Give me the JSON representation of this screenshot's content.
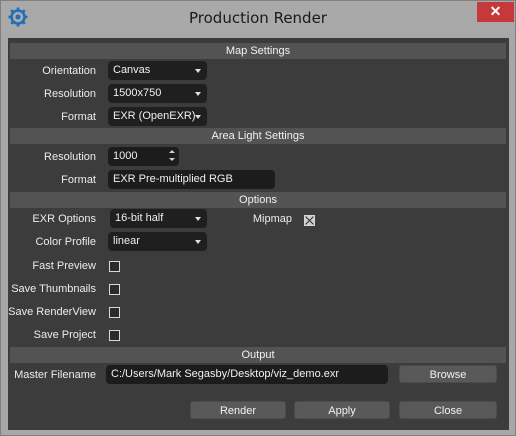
{
  "window": {
    "title": "Production Render",
    "close_glyph": "✕",
    "app_icon": "gear-icon"
  },
  "sections": {
    "map_settings": "Map Settings",
    "area_light_settings": "Area Light Settings",
    "options": "Options",
    "output": "Output"
  },
  "map_settings": {
    "orientation": {
      "label": "Orientation",
      "value": "Canvas"
    },
    "resolution": {
      "label": "Resolution",
      "value": "1500x750"
    },
    "format": {
      "label": "Format",
      "value": "EXR (OpenEXR)"
    }
  },
  "area_light_settings": {
    "resolution": {
      "label": "Resolution",
      "value": "1000"
    },
    "format": {
      "label": "Format",
      "value": "EXR Pre-multiplied RGB"
    }
  },
  "options": {
    "exr_options": {
      "label": "EXR Options",
      "value": "16-bit half"
    },
    "mipmap": {
      "label": "Mipmap",
      "checked": true
    },
    "color_profile": {
      "label": "Color Profile",
      "value": "linear"
    },
    "fast_preview": {
      "label": "Fast Preview",
      "checked": false
    },
    "save_thumbnails": {
      "label": "Save Thumbnails",
      "checked": false
    },
    "save_renderview": {
      "label": "Save RenderView",
      "checked": false
    },
    "save_project": {
      "label": "Save Project",
      "checked": false
    }
  },
  "output": {
    "master_filename": {
      "label": "Master Filename",
      "value": "C:/Users/Mark Segasby/Desktop/viz_demo.exr"
    },
    "browse_label": "Browse"
  },
  "buttons": {
    "render": "Render",
    "apply": "Apply",
    "close": "Close"
  },
  "colors": {
    "panel_bg": "#3c3c3c",
    "section_header": "#535353",
    "field_bg": "#1f1f1f",
    "close_red": "#c7383b"
  }
}
